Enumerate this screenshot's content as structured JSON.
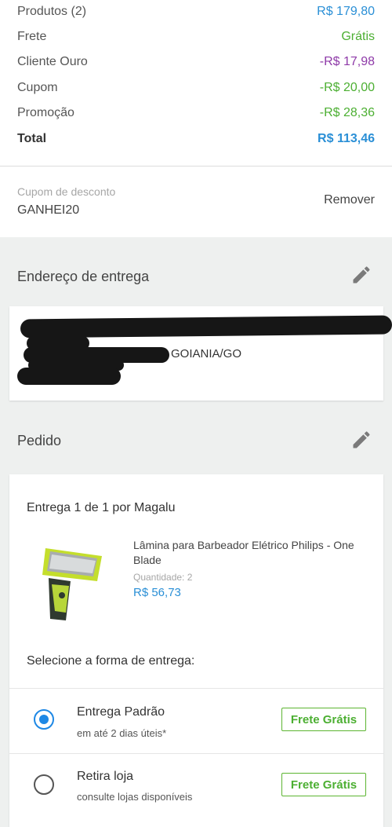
{
  "summary": {
    "rows": [
      {
        "label": "Produtos (2)",
        "value": "R$ 179,80",
        "color": "#2a8fd6"
      },
      {
        "label": "Frete",
        "value": "Grátis",
        "color": "#4caf32"
      },
      {
        "label": "Cliente Ouro",
        "value": "-R$ 17,98",
        "color": "#8e3aa8"
      },
      {
        "label": "Cupom",
        "value": "-R$ 20,00",
        "color": "#4caf32"
      },
      {
        "label": "Promoção",
        "value": "-R$ 28,36",
        "color": "#4caf32"
      }
    ],
    "total_label": "Total",
    "total_value": "R$ 113,46"
  },
  "coupon": {
    "label": "Cupom de desconto",
    "code": "GANHEI20",
    "remove_label": "Remover"
  },
  "address": {
    "title": "Endereço de entrega",
    "edit_icon": "pencil-icon",
    "city": "GOIANIA/GO"
  },
  "order": {
    "title": "Pedido",
    "edit_icon": "pencil-icon",
    "delivery_title": "Entrega 1 de 1 por Magalu",
    "product": {
      "name": "Lâmina para Barbeador Elétrico Philips - One Blade",
      "quantity": "Quantidade: 2",
      "price": "R$ 56,73"
    },
    "select_label": "Selecione a forma de entrega:",
    "options": [
      {
        "name": "Entrega Padrão",
        "sub": "em até 2 dias úteis*",
        "badge": "Frete Grátis",
        "selected": true
      },
      {
        "name": "Retira loja",
        "sub": "consulte lojas disponíveis",
        "badge": "Frete Grátis",
        "selected": false
      }
    ]
  },
  "colors": {
    "accent_blue": "#2a8fd6",
    "green": "#4caf32",
    "purple": "#8e3aa8",
    "radio_blue": "#1e88e5"
  }
}
